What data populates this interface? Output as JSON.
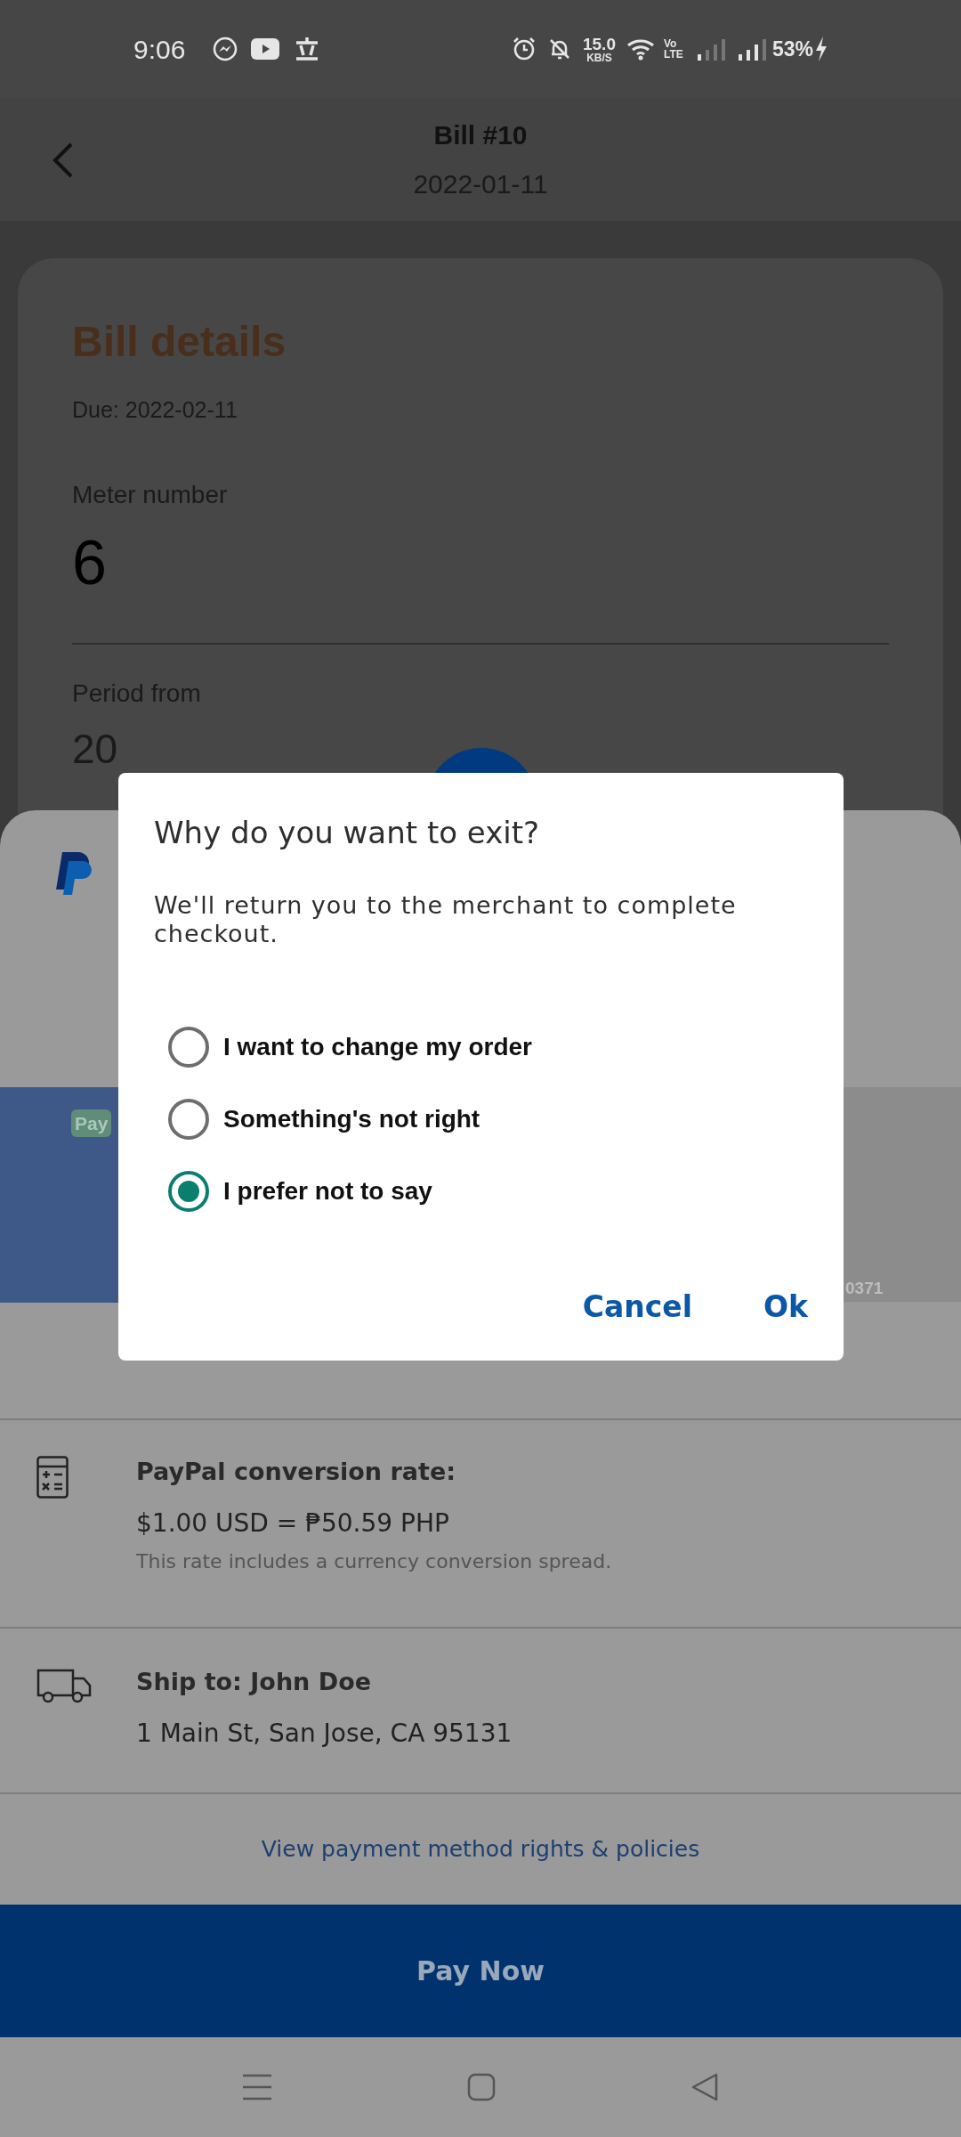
{
  "status_bar": {
    "time": "9:06",
    "network_speed": "15.0",
    "network_speed_unit": "KB/S",
    "volte": "Vo LTE",
    "battery": "53%"
  },
  "header": {
    "title": "Bill #10",
    "subtitle": "2022-01-11"
  },
  "bill_card": {
    "title": "Bill details",
    "due": "Due: 2022-02-11",
    "meter_label": "Meter number",
    "meter_value": "6",
    "period_label": "Period from",
    "period_value": "20"
  },
  "payment_sheet": {
    "card_tag": "Pay",
    "card_digits": "0371",
    "conversion": {
      "title": "PayPal conversion rate:",
      "rate": "$1.00 USD = ₱50.59 PHP",
      "note": "This rate includes a currency conversion spread."
    },
    "shipping": {
      "title": "Ship to: John Doe",
      "address": "1 Main St, San Jose, CA 95131"
    },
    "policies_link": "View payment method rights & policies",
    "pay_button": "Pay Now"
  },
  "dialog": {
    "title": "Why do you want to exit?",
    "message": "We'll return you to the merchant to complete checkout.",
    "options": [
      {
        "label": "I want to change my order",
        "selected": false
      },
      {
        "label": "Something's not right",
        "selected": false
      },
      {
        "label": "I prefer not to say",
        "selected": true
      }
    ],
    "buttons": [
      "Cancel",
      "Ok"
    ]
  }
}
